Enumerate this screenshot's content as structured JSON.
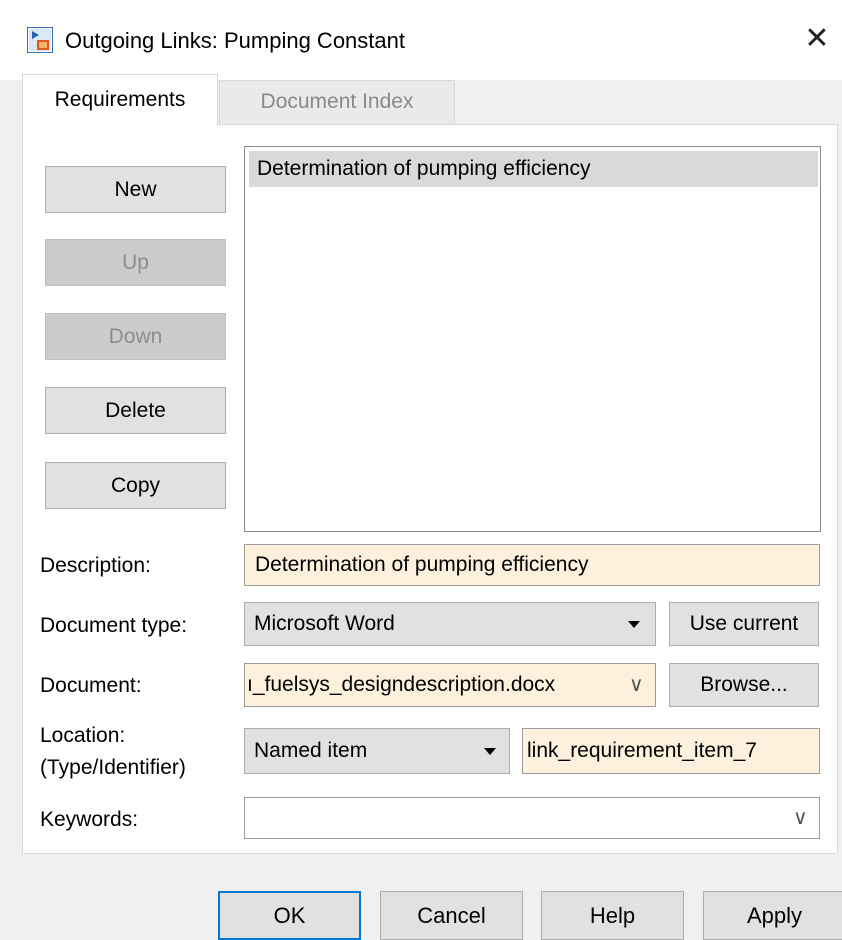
{
  "window": {
    "title": "Outgoing Links: Pumping Constant",
    "icon": "simulink-model-icon",
    "close_glyph": "✕"
  },
  "tabs": [
    {
      "label": "Requirements",
      "active": true
    },
    {
      "label": "Document Index",
      "active": false
    }
  ],
  "side_buttons": [
    {
      "label": "New",
      "enabled": true
    },
    {
      "label": "Up",
      "enabled": false
    },
    {
      "label": "Down",
      "enabled": false
    },
    {
      "label": "Delete",
      "enabled": true
    },
    {
      "label": "Copy",
      "enabled": true
    }
  ],
  "requirements_list": {
    "items": [
      "Determination of pumping efficiency"
    ],
    "selected": "Determination of pumping efficiency"
  },
  "form": {
    "description": {
      "label": "Description:",
      "value": "Determination of pumping efficiency"
    },
    "document_type": {
      "label": "Document type:",
      "value": "Microsoft Word",
      "button": "Use current"
    },
    "document": {
      "label": "Document:",
      "value": "ı_fuelsys_designdescription.docx",
      "button": "Browse..."
    },
    "location": {
      "label_line1": "Location:",
      "label_line2": "(Type/Identifier)",
      "type_value": "Named item",
      "identifier_value": "link_requirement_item_7"
    },
    "keywords": {
      "label": "Keywords:",
      "value": ""
    }
  },
  "dialog_buttons": {
    "ok": "OK",
    "cancel": "Cancel",
    "help": "Help",
    "apply": "Apply"
  },
  "colors": {
    "accent": "#0078d7",
    "editable_field_bg": "#fdf0dc",
    "button_bg": "#e1e1e1",
    "selection_bg": "#d9d9d9"
  }
}
